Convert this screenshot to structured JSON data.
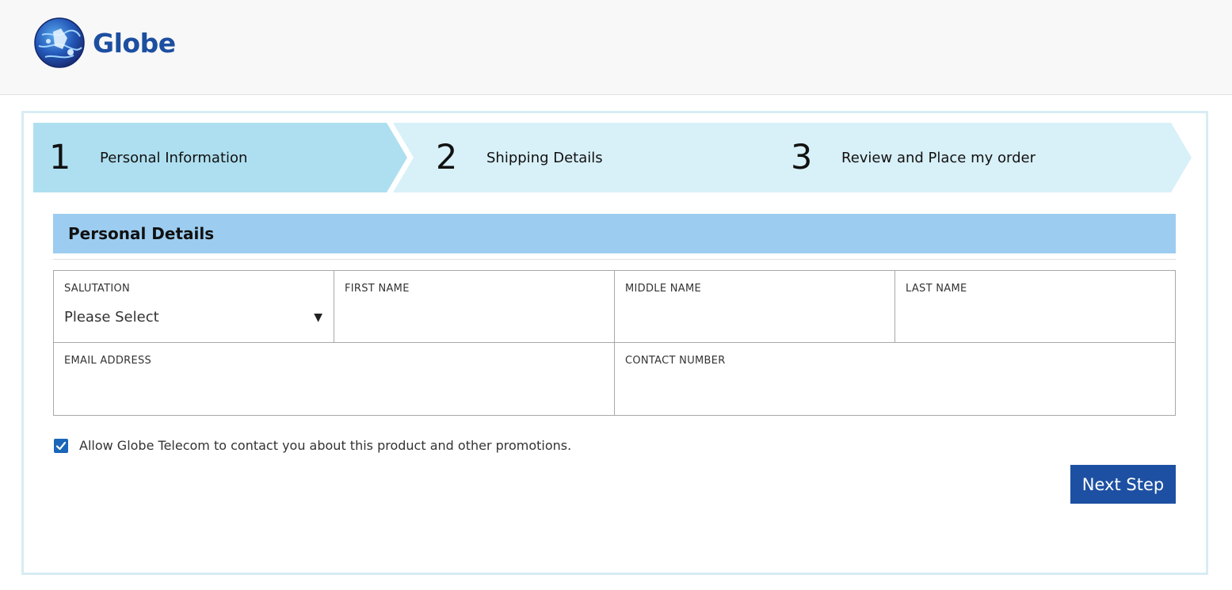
{
  "header": {
    "brand": "Globe"
  },
  "steps": [
    {
      "number": "1",
      "label": "Personal Information",
      "active": true
    },
    {
      "number": "2",
      "label": "Shipping Details",
      "active": false
    },
    {
      "number": "3",
      "label": "Review and Place my order",
      "active": false
    }
  ],
  "section": {
    "title": "Personal Details"
  },
  "form": {
    "salutation": {
      "label": "SALUTATION",
      "value": "Please Select"
    },
    "first_name": {
      "label": "FIRST NAME",
      "value": ""
    },
    "middle_name": {
      "label": "MIDDLE NAME",
      "value": ""
    },
    "last_name": {
      "label": "LAST NAME",
      "value": ""
    },
    "email": {
      "label": "EMAIL ADDRESS",
      "value": ""
    },
    "contact": {
      "label": "CONTACT NUMBER",
      "value": ""
    }
  },
  "consent": {
    "checked": true,
    "text": "Allow Globe Telecom to contact you about this product and other promotions."
  },
  "actions": {
    "next_label": "Next Step"
  },
  "colors": {
    "brand_blue": "#1d50a2",
    "step_active": "#aedff0",
    "step_inactive": "#d8f0f8",
    "section_bar": "#9ccdf0"
  },
  "icons": {
    "logo": "globe-logo-icon",
    "caret": "caret-down-icon",
    "check": "check-icon"
  }
}
